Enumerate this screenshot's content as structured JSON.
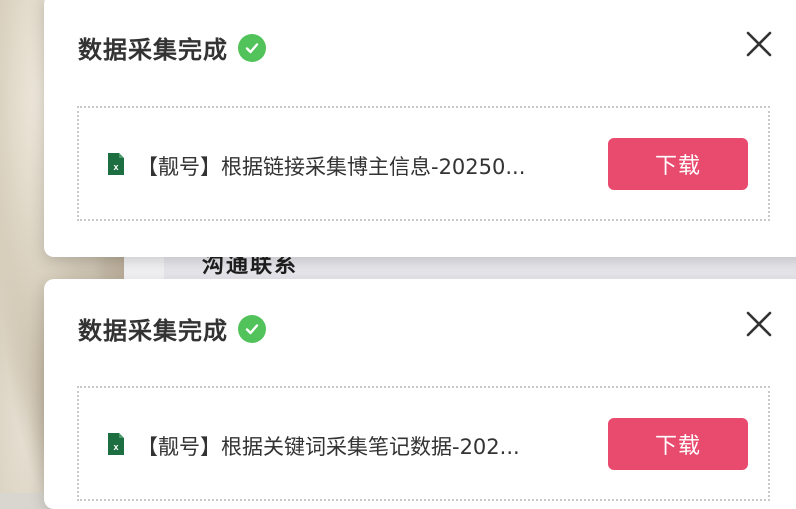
{
  "background": {
    "partial_text": "沟通联系"
  },
  "notifications": [
    {
      "title": "数据采集完成",
      "file_name": "【靓号】根据链接采集博主信息-20250...",
      "download_label": "下载"
    },
    {
      "title": "数据采集完成",
      "file_name": "【靓号】根据关键词采集笔记数据-202...",
      "download_label": "下载"
    }
  ],
  "colors": {
    "success": "#52c35a",
    "download_button": "#e94b6e",
    "excel_icon": "#1d6f42"
  },
  "icons": {
    "status": "check-circle-icon",
    "close": "close-icon",
    "file": "excel-file-icon"
  }
}
